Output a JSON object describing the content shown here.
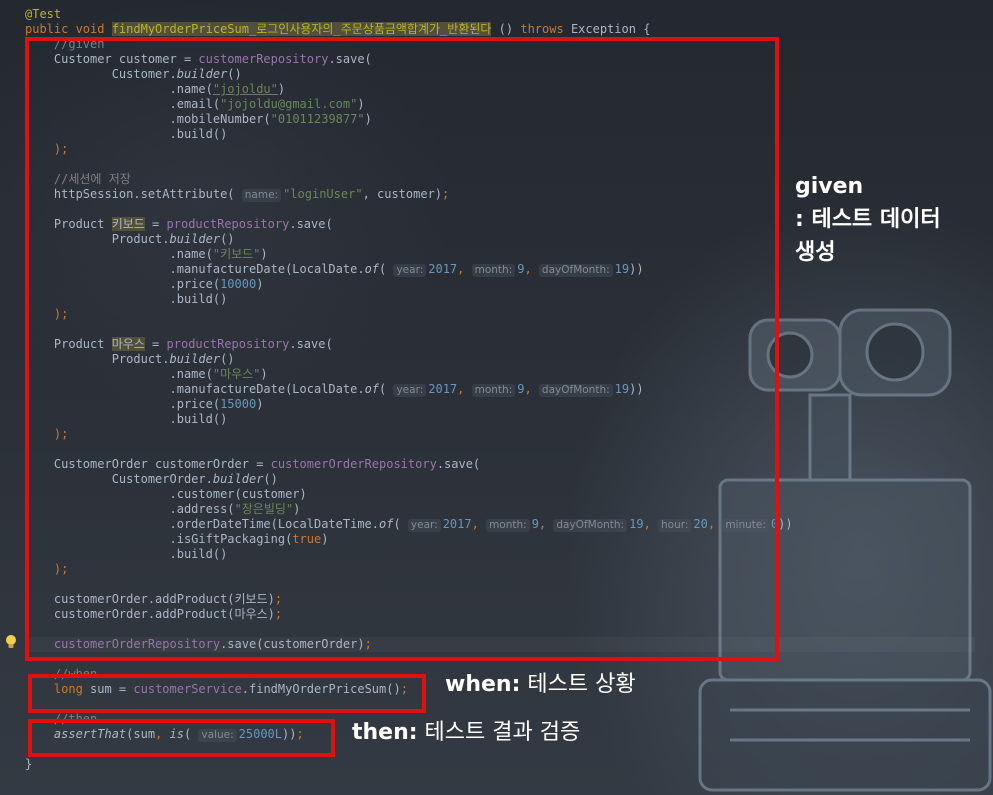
{
  "code_lines": [
    [
      {
        "t": "@Test",
        "c": "ann"
      }
    ],
    [
      {
        "t": "public void ",
        "c": "kw"
      },
      {
        "t": "findMyOrderPriceSum_로그인사용자의_주문상품금액합계가_반환된다",
        "c": "ann hl"
      },
      {
        "t": " () "
      },
      {
        "t": "throws",
        "c": "kw"
      },
      {
        "t": " Exception {"
      }
    ],
    [
      {
        "t": "    //given",
        "c": "cmt"
      }
    ],
    [
      {
        "t": "    Customer customer = "
      },
      {
        "t": "customerRepository",
        "c": "fld"
      },
      {
        "t": ".save("
      }
    ],
    [
      {
        "t": "            Customer."
      },
      {
        "t": "builder",
        "c": "ital"
      },
      {
        "t": "()"
      }
    ],
    [
      {
        "t": "                    .name("
      },
      {
        "t": "\"jojoldu\"",
        "c": "str under"
      },
      {
        "t": ")"
      }
    ],
    [
      {
        "t": "                    .email("
      },
      {
        "t": "\"jojoldu@gmail.com\"",
        "c": "str"
      },
      {
        "t": ")"
      }
    ],
    [
      {
        "t": "                    .mobileNumber("
      },
      {
        "t": "\"01011239877\"",
        "c": "str"
      },
      {
        "t": ")"
      }
    ],
    [
      {
        "t": "                    .build()"
      }
    ],
    [
      {
        "t": "    );",
        "c": "kw"
      }
    ],
    [],
    [
      {
        "t": "    //세션에 저장",
        "c": "cmt"
      }
    ],
    [
      {
        "t": "    httpSession.setAttribute( "
      },
      {
        "h": "name:"
      },
      {
        "t": "\"loginUser\"",
        "c": "str"
      },
      {
        "t": ", customer)"
      },
      {
        "t": ";",
        "c": "kw"
      }
    ],
    [],
    [
      {
        "t": "    Product "
      },
      {
        "t": "키보드",
        "c": "hl"
      },
      {
        "t": " = "
      },
      {
        "t": "productRepository",
        "c": "fld"
      },
      {
        "t": ".save("
      }
    ],
    [
      {
        "t": "            Product."
      },
      {
        "t": "builder",
        "c": "ital"
      },
      {
        "t": "()"
      }
    ],
    [
      {
        "t": "                    .name("
      },
      {
        "t": "\"키보드\"",
        "c": "str"
      },
      {
        "t": ")"
      }
    ],
    [
      {
        "t": "                    .manufactureDate(LocalDate."
      },
      {
        "t": "of",
        "c": "ital"
      },
      {
        "t": "( "
      },
      {
        "h": "year:"
      },
      {
        "t": "2017",
        "c": "num"
      },
      {
        "t": ", ",
        "c": "kw"
      },
      {
        "h": "month:"
      },
      {
        "t": "9",
        "c": "num"
      },
      {
        "t": ", ",
        "c": "kw"
      },
      {
        "h": "dayOfMonth:"
      },
      {
        "t": "19",
        "c": "num"
      },
      {
        "t": "))"
      }
    ],
    [
      {
        "t": "                    .price("
      },
      {
        "t": "10000",
        "c": "num"
      },
      {
        "t": ")"
      }
    ],
    [
      {
        "t": "                    .build()"
      }
    ],
    [
      {
        "t": "    );",
        "c": "kw"
      }
    ],
    [],
    [
      {
        "t": "    Product "
      },
      {
        "t": "마우스",
        "c": "hl"
      },
      {
        "t": " = "
      },
      {
        "t": "productRepository",
        "c": "fld"
      },
      {
        "t": ".save("
      }
    ],
    [
      {
        "t": "            Product."
      },
      {
        "t": "builder",
        "c": "ital"
      },
      {
        "t": "()"
      }
    ],
    [
      {
        "t": "                    .name("
      },
      {
        "t": "\"마우스\"",
        "c": "str"
      },
      {
        "t": ")"
      }
    ],
    [
      {
        "t": "                    .manufactureDate(LocalDate."
      },
      {
        "t": "of",
        "c": "ital"
      },
      {
        "t": "( "
      },
      {
        "h": "year:"
      },
      {
        "t": "2017",
        "c": "num"
      },
      {
        "t": ", ",
        "c": "kw"
      },
      {
        "h": "month:"
      },
      {
        "t": "9",
        "c": "num"
      },
      {
        "t": ", ",
        "c": "kw"
      },
      {
        "h": "dayOfMonth:"
      },
      {
        "t": "19",
        "c": "num"
      },
      {
        "t": "))"
      }
    ],
    [
      {
        "t": "                    .price("
      },
      {
        "t": "15000",
        "c": "num"
      },
      {
        "t": ")"
      }
    ],
    [
      {
        "t": "                    .build()"
      }
    ],
    [
      {
        "t": "    );",
        "c": "kw"
      }
    ],
    [],
    [
      {
        "t": "    CustomerOrder customerOrder = "
      },
      {
        "t": "customerOrderRepository",
        "c": "fld"
      },
      {
        "t": ".save("
      }
    ],
    [
      {
        "t": "            CustomerOrder."
      },
      {
        "t": "builder",
        "c": "ital"
      },
      {
        "t": "()"
      }
    ],
    [
      {
        "t": "                    .customer(customer)"
      }
    ],
    [
      {
        "t": "                    .address("
      },
      {
        "t": "\"장은빌딩\"",
        "c": "str"
      },
      {
        "t": ")"
      }
    ],
    [
      {
        "t": "                    .orderDateTime(LocalDateTime."
      },
      {
        "t": "of",
        "c": "ital"
      },
      {
        "t": "( "
      },
      {
        "h": "year:"
      },
      {
        "t": "2017",
        "c": "num"
      },
      {
        "t": ", ",
        "c": "kw"
      },
      {
        "h": "month:"
      },
      {
        "t": "9",
        "c": "num"
      },
      {
        "t": ", ",
        "c": "kw"
      },
      {
        "h": "dayOfMonth:"
      },
      {
        "t": "19",
        "c": "num"
      },
      {
        "t": ", ",
        "c": "kw"
      },
      {
        "h": "hour:"
      },
      {
        "t": "20",
        "c": "num"
      },
      {
        "t": ", ",
        "c": "kw"
      },
      {
        "h": "minute:"
      },
      {
        "t": "0",
        "c": "num"
      },
      {
        "t": "))"
      }
    ],
    [
      {
        "t": "                    .isGiftPackaging("
      },
      {
        "t": "true",
        "c": "kw"
      },
      {
        "t": ")"
      }
    ],
    [
      {
        "t": "                    .build()"
      }
    ],
    [
      {
        "t": "    );",
        "c": "kw"
      }
    ],
    [],
    [
      {
        "t": "    customerOrder.addProduct(키보드)"
      },
      {
        "t": ";",
        "c": "kw"
      }
    ],
    [
      {
        "t": "    customerOrder.addProduct(마우스)"
      },
      {
        "t": ";",
        "c": "kw"
      }
    ],
    [],
    [
      {
        "t": "    "
      },
      {
        "t": "customerOrderRepository",
        "c": "fld"
      },
      {
        "t": ".save(customerOrder)"
      },
      {
        "t": ";",
        "c": "kw"
      }
    ],
    [],
    [
      {
        "t": "    //when",
        "c": "cmt"
      }
    ],
    [
      {
        "t": "    "
      },
      {
        "t": "long",
        "c": "kw"
      },
      {
        "t": " sum = "
      },
      {
        "t": "customerService",
        "c": "fld"
      },
      {
        "t": ".findMyOrderPriceSum()"
      },
      {
        "t": ";",
        "c": "kw"
      }
    ],
    [],
    [
      {
        "t": "    //then",
        "c": "cmt"
      }
    ],
    [
      {
        "t": "    "
      },
      {
        "t": "assertThat",
        "c": "ital"
      },
      {
        "t": "(sum"
      },
      {
        "t": ", ",
        "c": "kw"
      },
      {
        "t": "is",
        "c": "ital"
      },
      {
        "t": "( "
      },
      {
        "h": "value:"
      },
      {
        "t": "25000L",
        "c": "num"
      },
      {
        "t": "))"
      },
      {
        "t": ";",
        "c": "kw"
      }
    ],
    [],
    [
      {
        "t": "}"
      }
    ]
  ],
  "annotations": {
    "given_title": "given",
    "given_desc_1": ": 테스트 데이터",
    "given_desc_2": "생성",
    "when_title": "when:",
    "when_desc": " 테스트 상황",
    "then_title": "then:",
    "then_desc": " 테스트 결과 검증"
  },
  "colors": {
    "highlight_box": "#e01010",
    "keyword": "#cc7832",
    "string": "#6a8759",
    "number": "#6897bb",
    "field": "#9876aa",
    "comment": "#808080",
    "annotation": "#bbb529"
  },
  "icons": {
    "bulb": "lightbulb-icon",
    "background": "robot-illustration"
  }
}
